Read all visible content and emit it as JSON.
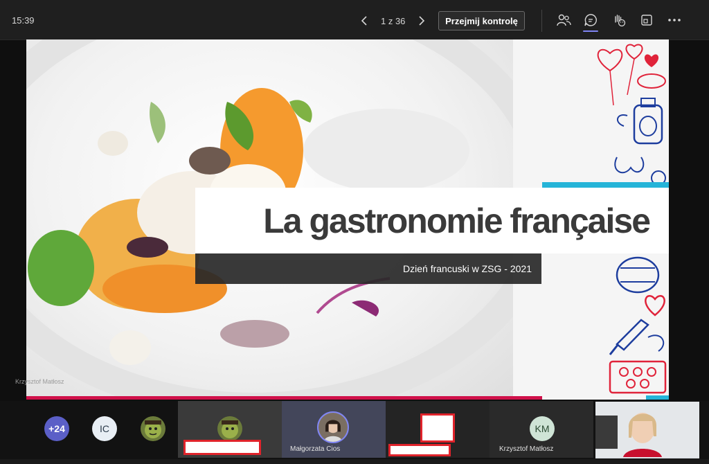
{
  "topbar": {
    "time": "15:39",
    "page_indicator": "1 z 36",
    "take_control_label": "Przejmij kontrolę"
  },
  "slide": {
    "title": "La gastronomie française",
    "subtitle": "Dzień francuski w ZSG - 2021",
    "presenter_label": "Krzysztof Matłosz",
    "colors": {
      "title_bar": "#ffffff",
      "subtitle_bar": "#2a2a2a",
      "cyan_accent": "#25b4d8",
      "red_accent": "#d0114a",
      "doodle_red": "#e0233a",
      "doodle_blue": "#1d3d9e"
    }
  },
  "participants": {
    "overflow_count": "+24",
    "ic_initials": "IC",
    "km_initials": "KM",
    "malgorzata_name": "Małgorzata Cios",
    "krzysztof_name": "Krzysztof Matłosz"
  }
}
